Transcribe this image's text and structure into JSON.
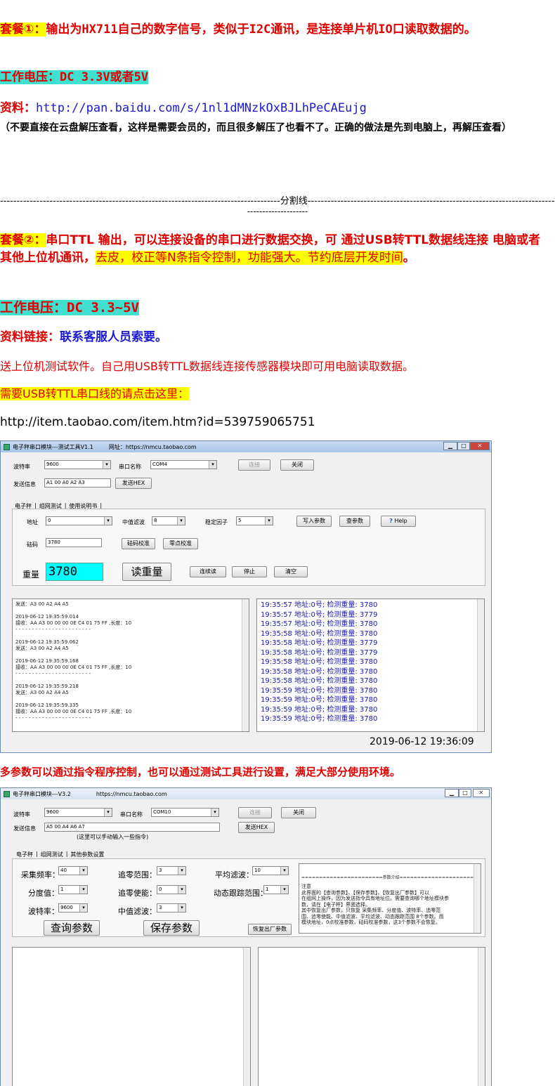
{
  "top_dash": "--------------------",
  "pkg1": {
    "label": "套餐①：",
    "text": "输出为HX711自己的数字信号，类似于I2C通讯，是连接单片机IO口读取数据的。",
    "voltage": "工作电压：DC 3.3V或者5V",
    "data_label": "资料：",
    "link": "http://pan.baidu.com/s/1nl1dMNzkOxBJLhPeCAEujg",
    "note": "（不要直接在云盘解压查看，这样是需要会员的，而且很多解压了也看不了。正确的做法是先到电脑上，再解压查看）"
  },
  "divider": {
    "left": "-------------------------------------------------------------------------------------",
    "label": "分割线",
    "right": "----------------------------------------------------------------------------------------",
    "tail": "--------------------"
  },
  "pkg2": {
    "label": "套餐②：",
    "text": "串口TTL 输出，可以连接设备的串口进行数据交换，可 通过USB转TTL数据线连接  电脑或者其他上位机通讯，",
    "highlight": "去皮，校正等N条指令控制，功能强大。节约底层开发时间",
    "end": "。",
    "voltage": "工作电压：DC 3.3~5V",
    "data_label": "资料链接：",
    "data_value": "联系客服人员索要。",
    "software_note": "送上位机测试软件。自己用USB转TTL数据线连接传感器模块即可用电脑读取数据。",
    "cable_note": "需要USB转TTL串口线的请点击这里：",
    "cable_link": "http://item.taobao.com/item.htm?id=539759065751"
  },
  "win1": {
    "title": "电子秤串口模块---测试工具V1.1",
    "url": "网址：https://nmcu.taobao.com",
    "baud_label": "波特率",
    "baud": "9600",
    "port_label": "串口名称",
    "port": "COM4",
    "connect": "连接",
    "close": "关闭",
    "send_label": "发送信息",
    "send_value": "A1 00 A0 A2 A3",
    "send_hex": "发送HEX",
    "tabs": [
      "电子秤",
      "组网测试",
      "使用说明书"
    ],
    "addr_label": "地址",
    "addr": "0",
    "median_label": "中值滤波",
    "median": "8",
    "stable_label": "稳定因子",
    "stable": "5",
    "write_params": "写入参数",
    "read_params": "查参数",
    "help": "Help",
    "weight_code_label": "砝码",
    "weight_code": "3780",
    "calib": "砝码校准",
    "zero": "零点校准",
    "weight_label": "重量",
    "weight_value": "3780",
    "read_weight": "读重量",
    "continuous": "连续读",
    "stop": "停止",
    "clear": "清空",
    "log": [
      "发送：A3 00 A2 A4 A5",
      "",
      "2019-06-12 19:35:59.014",
      "接收：AA A3 00 00 00 0E C4 01 75 FF ,长度：10",
      "- - - - - - - - - - - - - - - - - - - - - - -",
      "",
      "2019-06-12 19:35:59.062",
      "发送：A3 00 A2 A4 A5",
      "",
      "2019-06-12 19:35:59.168",
      "接收：AA A3 00 00 00 0E C4 01 75 FF ,长度：10",
      "- - - - - - - - - - - - - - - - - - - - - - -",
      "",
      "2019-06-12 19:35:59.218",
      "发送：A3 00 A2 A4 A5",
      "",
      "2019-06-12 19:35:59.335",
      "接收：AA A3 00 00 00 0E C4 01 75 FF ,长度：10",
      "- - - - - - - - - - - - - - - - - - - - - - -"
    ],
    "records": [
      "19:35:57  地址:0号; 检测重量: 3780",
      "19:35:57  地址:0号; 检测重量: 3779",
      "19:35:57  地址:0号; 检测重量: 3780",
      "19:35:58  地址:0号; 检测重量: 3780",
      "19:35:58  地址:0号; 检测重量: 3779",
      "19:35:58  地址:0号; 检测重量: 3779",
      "19:35:58  地址:0号; 检测重量: 3780",
      "19:35:58  地址:0号; 检测重量: 3780",
      "19:35:58  地址:0号; 检测重量: 3780",
      "19:35:59  地址:0号; 检测重量: 3780",
      "19:35:59  地址:0号; 检测重量: 3780",
      "19:35:59  地址:0号; 检测重量: 3780",
      "19:35:59  地址:0号; 检测重量: 3780"
    ],
    "timestamp": "2019-06-12  19:36:09"
  },
  "multi_param_note": "多参数可以通过指令程序控制，也可以通过测试工具进行设置，满足大部分使用环境。",
  "win2": {
    "title": "电子秤串口模块---V3.2",
    "url": "https://nmcu.taobao.com",
    "baud_label": "波特率",
    "baud": "9600",
    "port_label": "串口名称",
    "port": "COM10",
    "connect": "连接",
    "close": "关闭",
    "send_label": "发送信息",
    "send_value": "A5 00 A4 A6 A7",
    "send_hint": "(这里可以手动输入一些指令)",
    "send_hex": "发送HEX",
    "tabs": [
      "电子秤",
      "组网测试",
      "其他参数设置"
    ],
    "sample_label": "采集频率：",
    "sample": "40",
    "zero_range_label": "追零范围：",
    "zero_range": "3",
    "avg_label": "平均滤波：",
    "avg": "10",
    "div_label": "分度值：",
    "div": "1",
    "zero_enable_label": "追零使能：",
    "zero_enable": "0",
    "dyn_label": "动态跟踪范围：",
    "dyn": "1",
    "baud2_label": "波特率：",
    "baud2": "9600",
    "median_label": "中值滤波：",
    "median": "3",
    "query": "查询参数",
    "save": "保存参数",
    "restore": "恢复出厂参数",
    "info_header": "=======================参数介绍=======================",
    "info_lines": [
      "注意",
      "  此界面的【查询参数】、【保存参数】、【恢复出厂参数】可以",
      "在组网上操作，因为发送指令具有地址位。需要查询哪个地址模块参",
      "数，请在【电子秤】界面选择。",
      "  其中恢复出厂参数，只恢复 采集频率、分度值、波特率、追零范",
      "围、追零使能、中值滤波、平均滤波、动态跟踪范围 8个参数。而",
      "模块地址，0点校准参数，砝码校准参数，这3个参数不会恢复。"
    ]
  }
}
